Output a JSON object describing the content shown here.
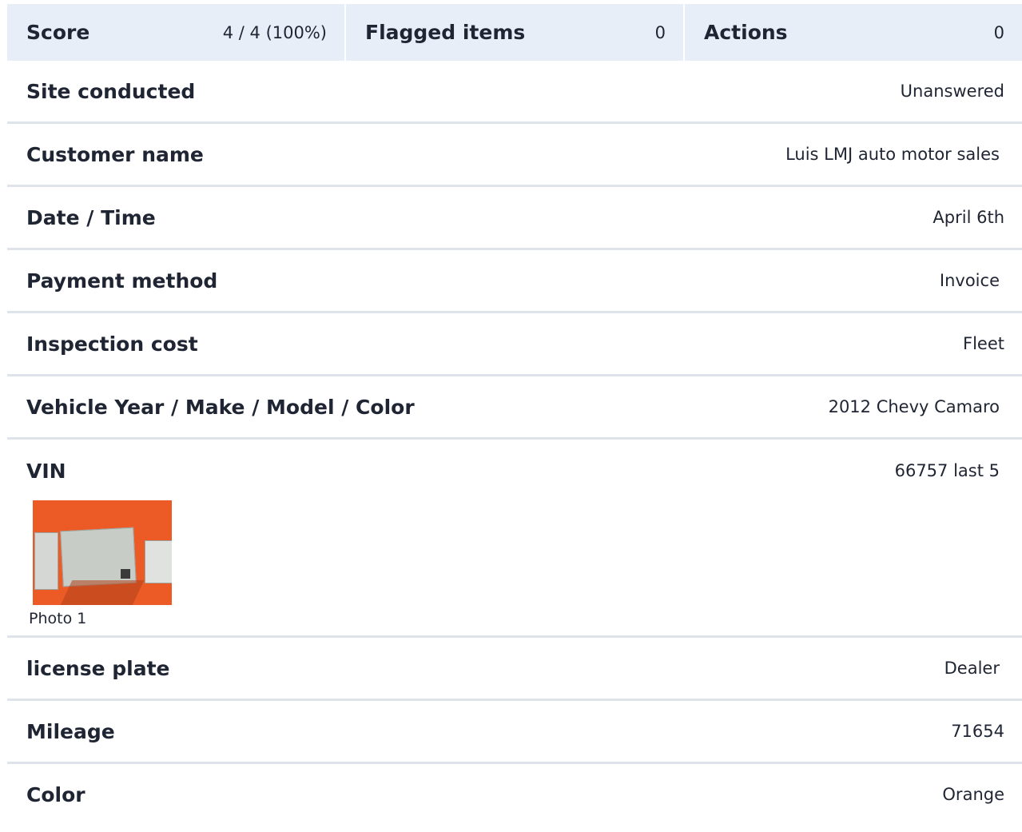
{
  "summary": {
    "score_label": "Score",
    "score_value": "4 / 4 (100%)",
    "flagged_label": "Flagged items",
    "flagged_value": "0",
    "actions_label": "Actions",
    "actions_value": "0"
  },
  "fields": {
    "site_conducted": {
      "label": "Site conducted",
      "value": "Unanswered"
    },
    "customer_name": {
      "label": "Customer name",
      "value": "Luis LMJ auto motor sales"
    },
    "date_time": {
      "label": "Date / Time",
      "value": "April 6th"
    },
    "payment_method": {
      "label": "Payment method",
      "value": "Invoice"
    },
    "inspection_cost": {
      "label": "Inspection cost",
      "value": "Fleet"
    },
    "vehicle": {
      "label": "Vehicle Year / Make / Model / Color",
      "value": "2012 Chevy Camaro"
    },
    "vin": {
      "label": "VIN",
      "value": "66757 last 5",
      "photo_caption": "Photo 1"
    },
    "license_plate": {
      "label": "license plate",
      "value": "Dealer"
    },
    "mileage": {
      "label": "Mileage",
      "value": "71654"
    },
    "color": {
      "label": "Color",
      "value": "Orange"
    }
  },
  "colors": {
    "summary_bg": "#e8eef8",
    "divider": "#dfe3ea",
    "photo_bg": "#ec5a26"
  }
}
